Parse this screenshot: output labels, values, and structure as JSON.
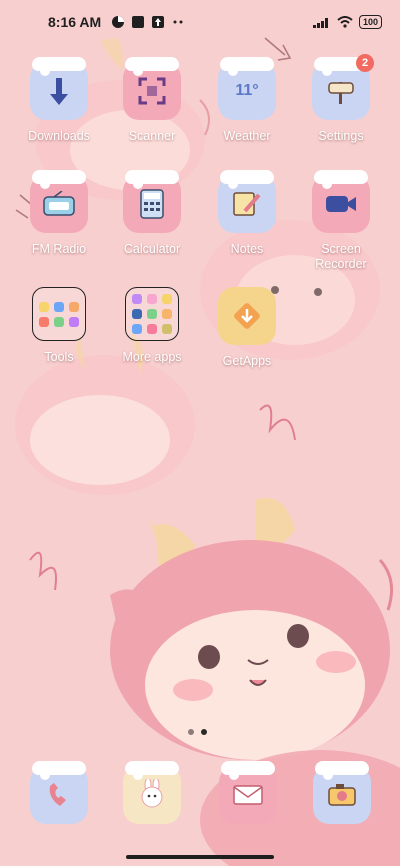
{
  "status_bar": {
    "time": "8:16 AM",
    "battery": "100",
    "icons": [
      "pie-icon",
      "square-icon",
      "upload-icon",
      "more-icon"
    ],
    "right_icons": [
      "signal-icon",
      "wifi-icon",
      "battery-icon"
    ]
  },
  "apps": [
    {
      "label": "Downloads",
      "icon": "download-icon",
      "color": "#c9d5f2"
    },
    {
      "label": "Scanner",
      "icon": "scan-icon",
      "color": "#f3a9b7"
    },
    {
      "label": "Weather",
      "icon": "weather-icon",
      "text": "11°",
      "color": "#c9d5f2"
    },
    {
      "label": "Settings",
      "icon": "settings-icon",
      "badge": "2",
      "color": "#c9d5f2"
    },
    {
      "label": "FM Radio",
      "icon": "radio-icon",
      "color": "#f3a9b7"
    },
    {
      "label": "Calculator",
      "icon": "calculator-icon",
      "color": "#f3a9b7"
    },
    {
      "label": "Notes",
      "icon": "notes-icon",
      "color": "#c9d5f2"
    },
    {
      "label": "Screen\nRecorder",
      "icon": "recorder-icon",
      "color": "#f3a9b7"
    },
    {
      "label": "Tools",
      "icon": "folder-icon"
    },
    {
      "label": "More apps",
      "icon": "folder-icon"
    },
    {
      "label": "GetApps",
      "icon": "getapps-icon",
      "color": "#f5d48c"
    }
  ],
  "dock": [
    {
      "icon": "phone-icon",
      "color": "#c9d5f2"
    },
    {
      "icon": "bunny-icon",
      "color": "#f7e6c4"
    },
    {
      "icon": "mail-icon",
      "color": "#f3a9b7"
    },
    {
      "icon": "camera-icon",
      "color": "#c9d5f2"
    }
  ],
  "pages": {
    "count": 2,
    "active": 2
  }
}
